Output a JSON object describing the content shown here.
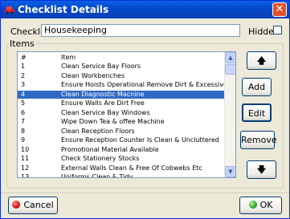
{
  "window": {
    "title": "Checklist Details"
  },
  "form": {
    "checklist_label": "Checklist",
    "checklist_value": "Housekeeping",
    "hidden_label": "Hidden",
    "items_group_label": "Items"
  },
  "list": {
    "headers": {
      "num": "#",
      "item": "Item"
    },
    "selected_index": 3,
    "rows": [
      {
        "num": "1",
        "item": "Clean Service Bay Floors"
      },
      {
        "num": "2",
        "item": "Clean Workbenches"
      },
      {
        "num": "3",
        "item": "Ensure Hoists Operational Remove Dirt & Excessive Grease"
      },
      {
        "num": "4",
        "item": "Clean Diagnostic Macnine"
      },
      {
        "num": "5",
        "item": "Ensure Walls Are Dirt Free"
      },
      {
        "num": "6",
        "item": "Clean Service Bay Windows"
      },
      {
        "num": "7",
        "item": "Wipe Down Tea & offee Machine"
      },
      {
        "num": "8",
        "item": "Clean Reception Floors"
      },
      {
        "num": "9",
        "item": "Ensure Reception Counter Is Clean & Uncluttered"
      },
      {
        "num": "10",
        "item": "Promotional Material Available"
      },
      {
        "num": "11",
        "item": "Check Stationery Stocks"
      },
      {
        "num": "12",
        "item": "External Walls Clean & Free Of Cobwebs Etc"
      },
      {
        "num": "13",
        "item": "Uniforms Clean & Tidy"
      }
    ]
  },
  "buttons": {
    "up": "🡅",
    "add": "Add",
    "edit": "Edit",
    "remove": "Remove",
    "down": "🡇",
    "cancel": "Cancel",
    "ok": "OK"
  }
}
